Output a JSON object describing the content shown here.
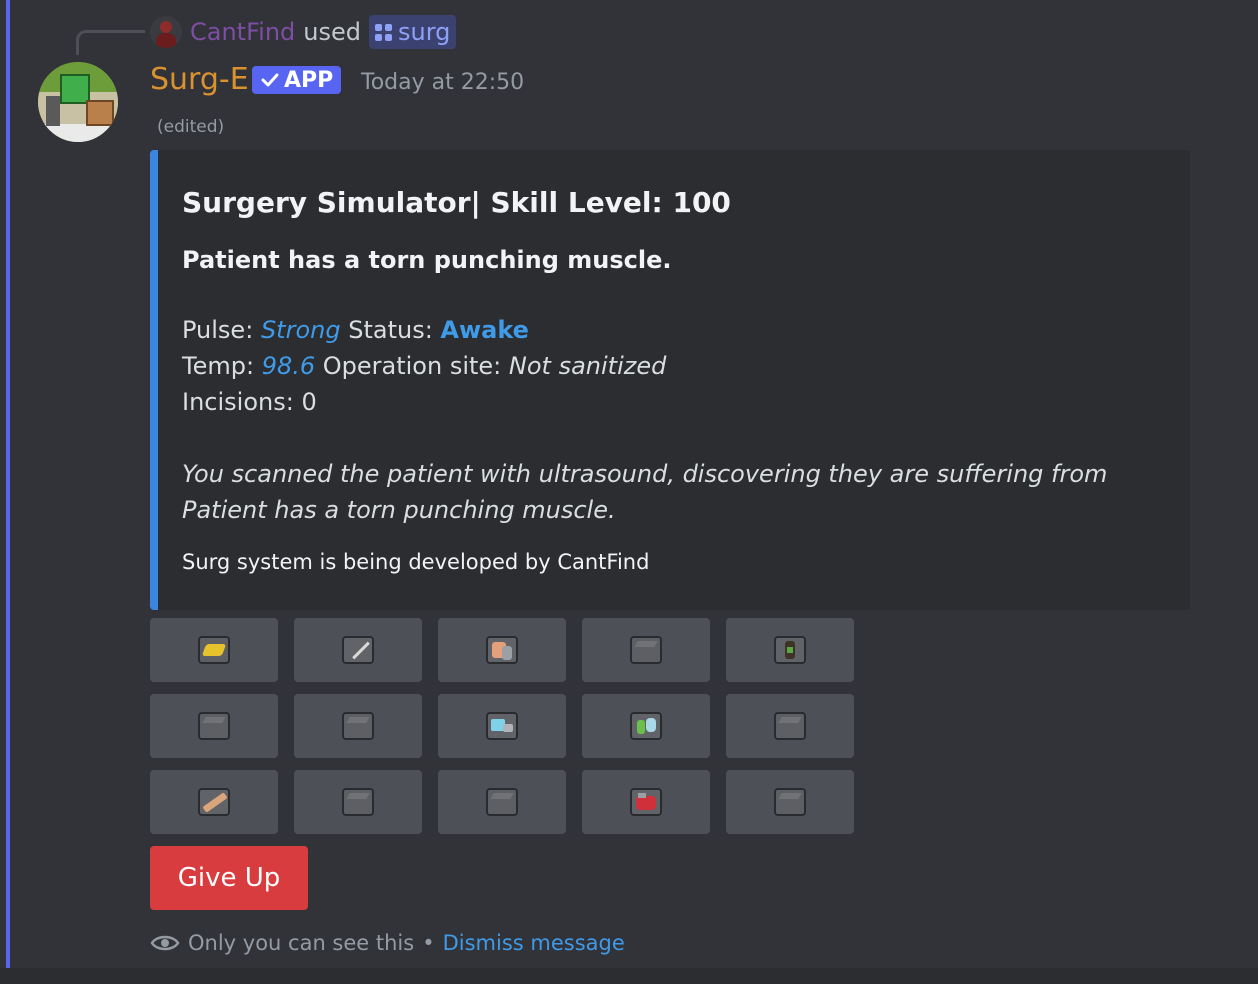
{
  "reply": {
    "user": "CantFind",
    "used_text": "used",
    "command": "surg"
  },
  "message": {
    "author": "Surg-E",
    "badge": "APP",
    "timestamp": "Today at 22:50",
    "edited": "(edited)"
  },
  "embed": {
    "accent_color": "#3b86e0",
    "title": "Surgery Simulator| Skill Level: 100",
    "diagnosis": "Patient has a torn punching muscle.",
    "pulse_label": "Pulse:",
    "pulse_value": "Strong",
    "status_label": "Status:",
    "status_value": "Awake",
    "temp_label": "Temp:",
    "temp_value": "98.6",
    "site_label": "Operation site:",
    "site_value": "Not sanitized",
    "incisions_label": "Incisions:",
    "incisions_value": "0",
    "scan_line1": "You scanned the patient with ultrasound, discovering they are suffering from",
    "scan_line2": "Patient has a torn punching muscle.",
    "footer": "Surg system is being developed by CantFind"
  },
  "tool_buttons": [
    [
      {
        "icon": "sponge-icon"
      },
      {
        "icon": "scalpel-icon"
      },
      {
        "icon": "stitches-icon"
      },
      {
        "icon": "empty-slot-icon"
      },
      {
        "icon": "antibiotics-icon"
      }
    ],
    [
      {
        "icon": "empty-slot-icon"
      },
      {
        "icon": "empty-slot-icon"
      },
      {
        "icon": "ultrasound-icon"
      },
      {
        "icon": "anesthetic-icon"
      },
      {
        "icon": "empty-slot-icon"
      }
    ],
    [
      {
        "icon": "splint-icon"
      },
      {
        "icon": "empty-slot-icon"
      },
      {
        "icon": "empty-slot-icon"
      },
      {
        "icon": "transfusion-icon"
      },
      {
        "icon": "empty-slot-icon"
      }
    ]
  ],
  "give_up_label": "Give Up",
  "ephemeral": {
    "text": "Only you can see this",
    "separator": "•",
    "dismiss": "Dismiss message"
  },
  "colors": {
    "background": "#313338",
    "brand": "#5865f2",
    "author": "#d9922f",
    "danger": "#d83c3e",
    "link": "#3f9ae8"
  }
}
